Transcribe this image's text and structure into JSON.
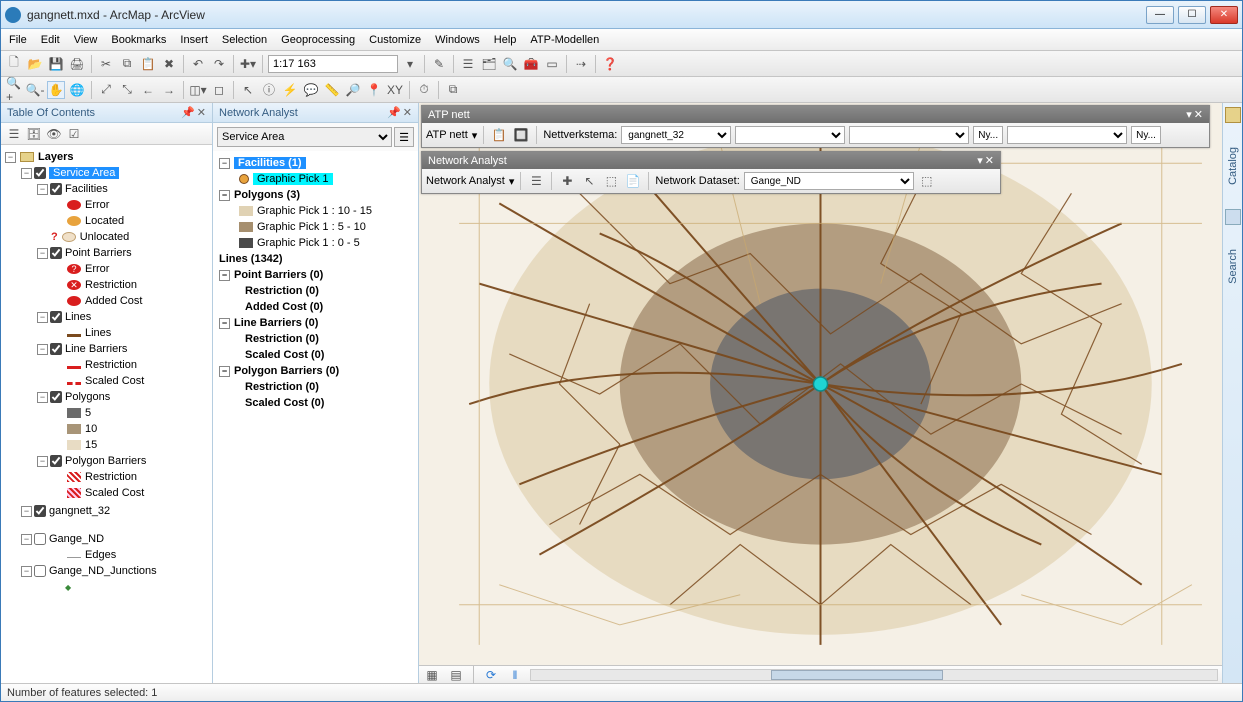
{
  "window": {
    "title": "gangnett.mxd - ArcMap - ArcView"
  },
  "menu": [
    "File",
    "Edit",
    "View",
    "Bookmarks",
    "Insert",
    "Selection",
    "Geoprocessing",
    "Customize",
    "Windows",
    "Help",
    "ATP-Modellen"
  ],
  "scale": "1:17 163",
  "toc": {
    "title": "Table Of Contents",
    "root": "Layers",
    "service_area": "Service Area",
    "facilities": "Facilities",
    "fac_error": "Error",
    "fac_located": "Located",
    "fac_unlocated": "Unlocated",
    "point_barriers": "Point Barriers",
    "pb_error": "Error",
    "pb_restriction": "Restriction",
    "pb_added": "Added Cost",
    "lines": "Lines",
    "lines_sub": "Lines",
    "line_barriers": "Line Barriers",
    "lb_restriction": "Restriction",
    "lb_scaled": "Scaled Cost",
    "polygons": "Polygons",
    "p5": "5",
    "p10": "10",
    "p15": "15",
    "polygon_barriers": "Polygon Barriers",
    "pgb_restriction": "Restriction",
    "pgb_scaled": "Scaled Cost",
    "gangnett": "gangnett_32",
    "gange_nd": "Gange_ND",
    "edges": "Edges",
    "gange_junc": "Gange_ND_Junctions"
  },
  "na": {
    "title": "Network Analyst",
    "select": "Service Area",
    "facilities": "Facilities (1)",
    "graphic_pick": "Graphic Pick 1",
    "polygons": "Polygons (3)",
    "poly1": "Graphic Pick 1 : 10 - 15",
    "poly2": "Graphic Pick 1 : 5 - 10",
    "poly3": "Graphic Pick 1 : 0 - 5",
    "lines": "Lines (1342)",
    "point_barriers": "Point Barriers (0)",
    "pb_restriction": "Restriction (0)",
    "pb_added": "Added Cost (0)",
    "line_barriers": "Line Barriers (0)",
    "lb_restriction": "Restriction (0)",
    "lb_scaled": "Scaled Cost (0)",
    "polygon_barriers": "Polygon Barriers (0)",
    "pgb_restriction": "Restriction (0)",
    "pgb_scaled": "Scaled Cost (0)"
  },
  "atp": {
    "title": "ATP nett",
    "label1": "ATP nett",
    "nettverkstema": "Nettverkstema:",
    "nett_val": "gangnett_32",
    "ny": "Ny...",
    "ny2": "Ny..."
  },
  "na_float": {
    "title": "Network Analyst",
    "label": "Network Analyst",
    "dataset_label": "Network Dataset:",
    "dataset_val": "Gange_ND"
  },
  "right": {
    "catalog": "Catalog",
    "search": "Search"
  },
  "status": "Number of features selected: 1"
}
